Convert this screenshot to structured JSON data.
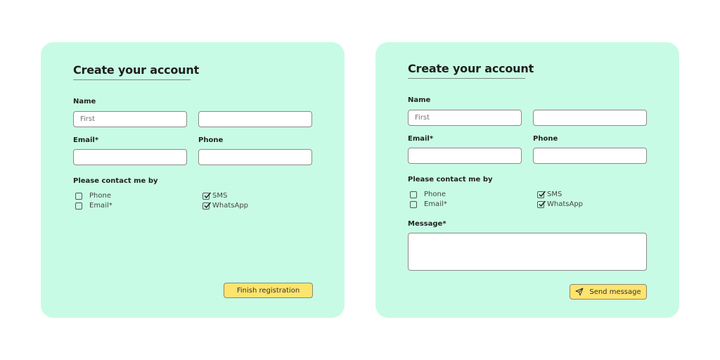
{
  "forms": [
    {
      "title": "Create your account",
      "name_label": "Name",
      "first_placeholder": "First",
      "last_placeholder": "",
      "email_label": "Email*",
      "phone_label": "Phone",
      "contact_label": "Please contact me by",
      "options": [
        {
          "label": "Phone",
          "checked": false
        },
        {
          "label": "Email*",
          "checked": false
        },
        {
          "label": "SMS",
          "checked": true
        },
        {
          "label": "WhatsApp",
          "checked": true
        }
      ],
      "submit_label": "Finish registration"
    },
    {
      "title": "Create your account",
      "name_label": "Name",
      "first_placeholder": "First",
      "last_placeholder": "",
      "email_label": "Email*",
      "phone_label": "Phone",
      "contact_label": "Please contact me by",
      "options": [
        {
          "label": "Phone",
          "checked": false
        },
        {
          "label": "Email*",
          "checked": false
        },
        {
          "label": "SMS",
          "checked": true
        },
        {
          "label": "WhatsApp",
          "checked": true
        }
      ],
      "message_label": "Message*",
      "submit_label": "Send message",
      "submit_icon": "send-icon"
    }
  ],
  "colors": {
    "card_bg": "#c8fbe5",
    "button_bg": "#fde46e"
  }
}
